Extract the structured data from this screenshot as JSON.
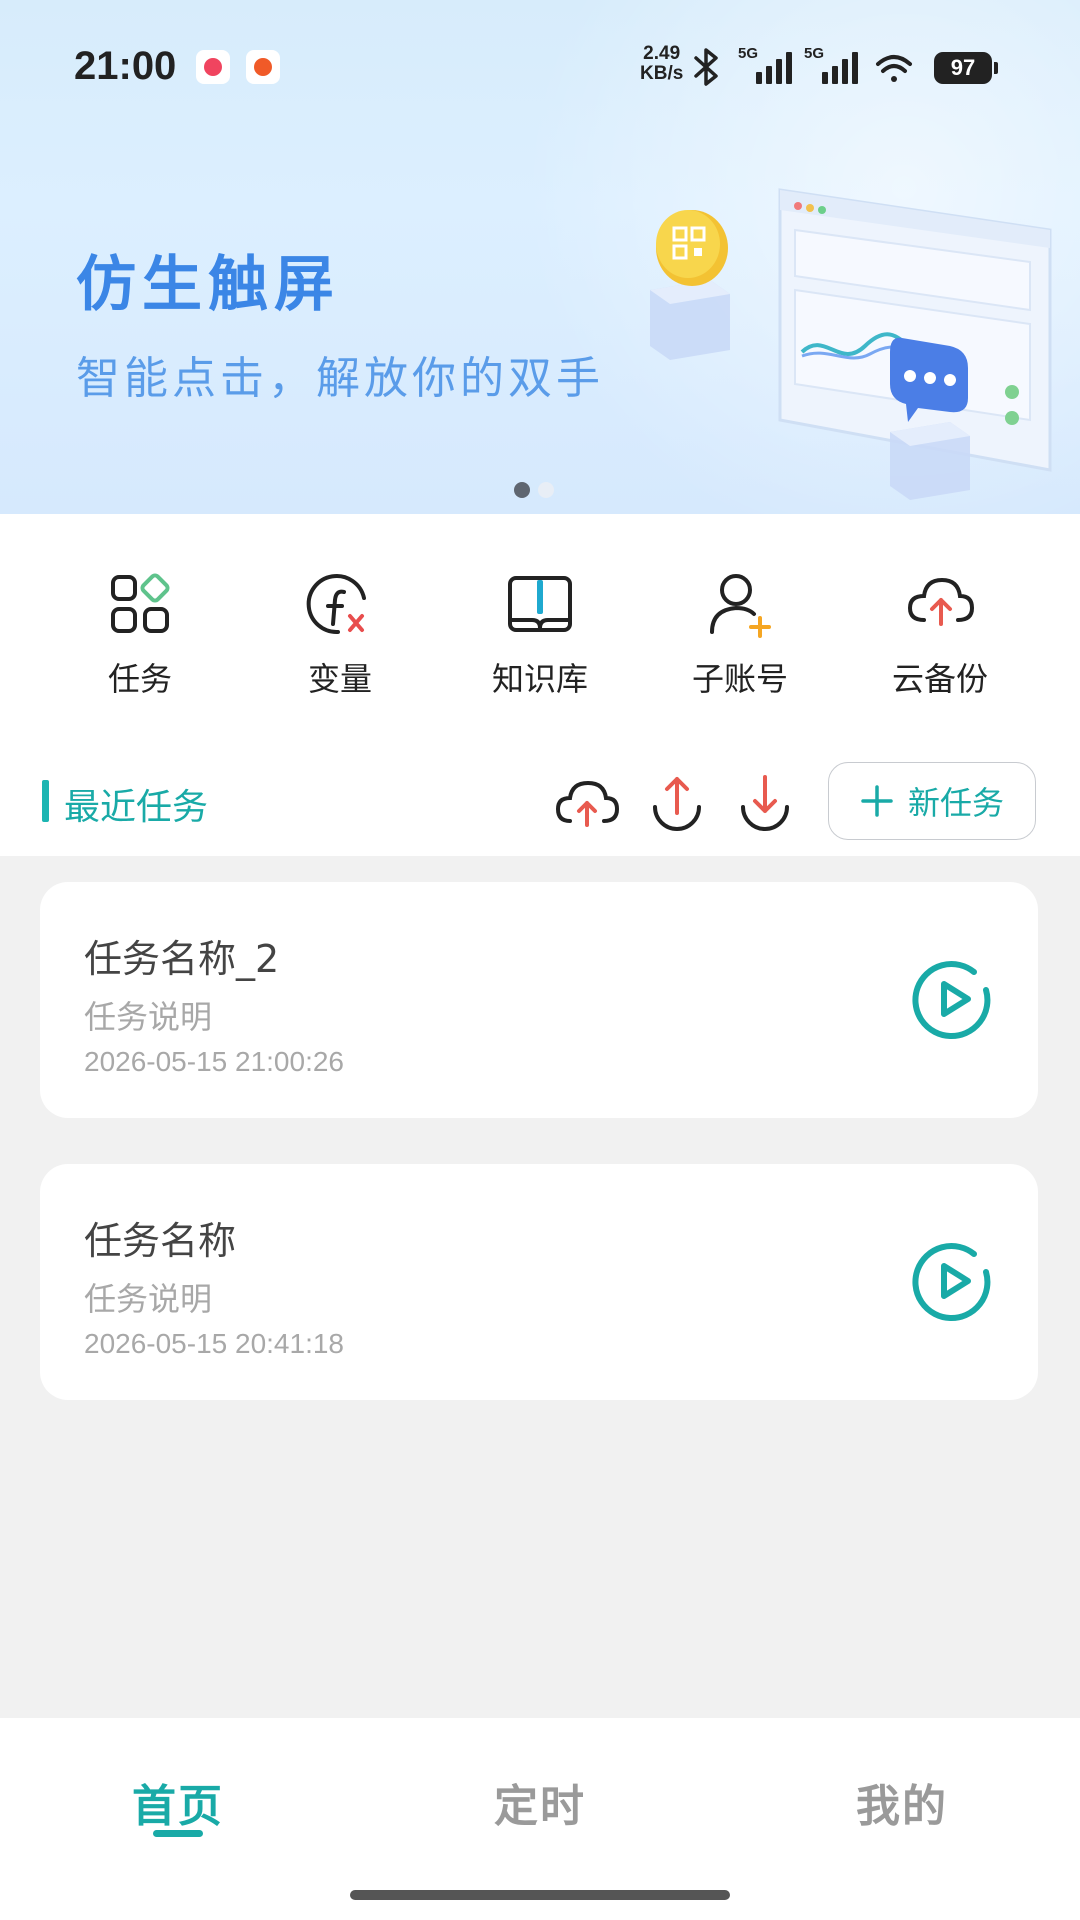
{
  "status_bar": {
    "time": "21:00",
    "net_speed_value": "2.49",
    "net_speed_unit": "KB/s",
    "signal_1_label": "5G",
    "signal_2_label": "5G",
    "battery": "97"
  },
  "banner": {
    "title": "仿生触屏",
    "subtitle": "智能点击，解放你的双手",
    "page_count": 2,
    "active_page": 1
  },
  "shortcuts": [
    {
      "label": "任务",
      "icon": "grid-shapes-icon"
    },
    {
      "label": "变量",
      "icon": "function-fx-icon"
    },
    {
      "label": "知识库",
      "icon": "book-icon"
    },
    {
      "label": "子账号",
      "icon": "add-user-icon"
    },
    {
      "label": "云备份",
      "icon": "cloud-upload-icon"
    }
  ],
  "recent": {
    "title": "最近任务",
    "new_task_label": "新任务"
  },
  "tasks": [
    {
      "name": "任务名称_2",
      "description": "任务说明",
      "time": "2026-05-15 21:00:26"
    },
    {
      "name": "任务名称",
      "description": "任务说明",
      "time": "2026-05-15 20:41:18"
    }
  ],
  "nav": {
    "items": [
      {
        "label": "首页",
        "active": true
      },
      {
        "label": "定时",
        "active": false
      },
      {
        "label": "我的",
        "active": false
      }
    ]
  },
  "colors": {
    "accent": "#19aaa7",
    "banner_title": "#3b86e6",
    "banner_subtitle": "#5a9ce9",
    "upload_red": "#e85a4f",
    "plus_orange": "#f5a623",
    "fx_red": "#e84d4d"
  }
}
